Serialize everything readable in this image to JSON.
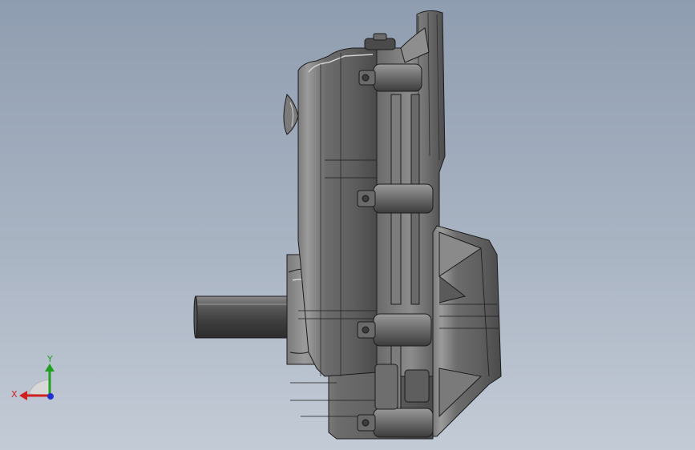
{
  "viewport": {
    "background_top": "#8f9db0",
    "background_bottom": "#c3cbd6"
  },
  "model": {
    "body_color": "#6e6e6e",
    "highlight_color": "#a8a8a8",
    "edge_color": "#1c1c1c",
    "accent_color": "#b04030"
  },
  "triad": {
    "x_label": "X",
    "y_label": "Y",
    "x_color": "#d02020",
    "y_color": "#20a020",
    "z_color": "#2030d0"
  }
}
